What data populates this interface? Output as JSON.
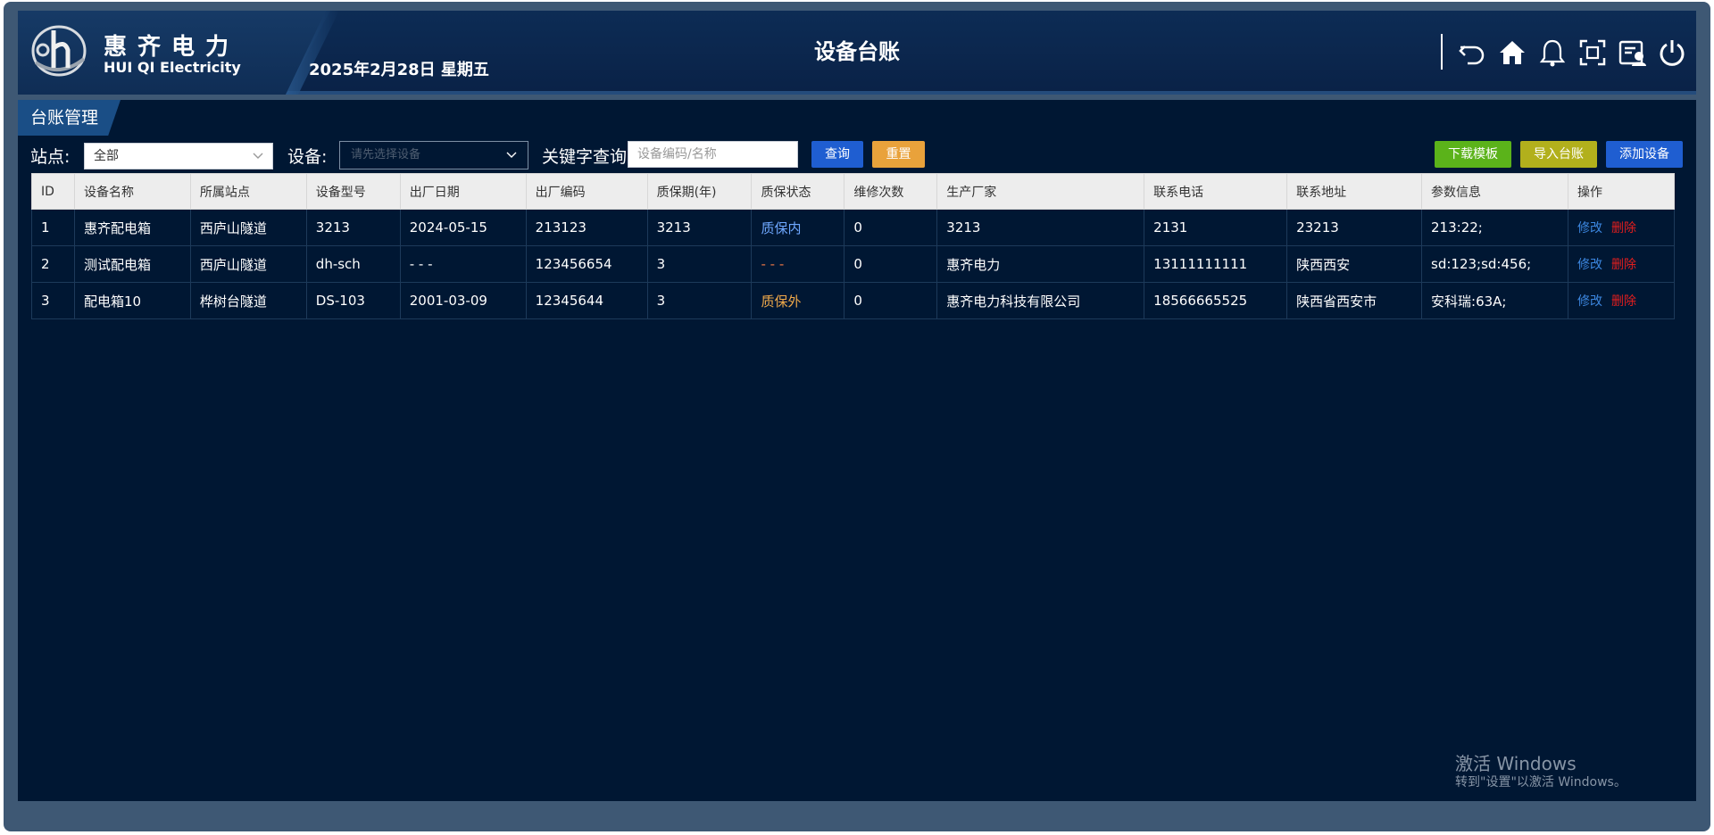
{
  "header": {
    "brand_cn": "惠齐电力",
    "brand_en": "HUI QI Electricity",
    "date": "2025年2月28日 星期五",
    "title": "设备台账",
    "icons": [
      "undo-icon",
      "home-icon",
      "bell-icon",
      "fullscreen-icon",
      "user-card-icon",
      "power-icon"
    ]
  },
  "section": {
    "tab": "台账管理"
  },
  "filters": {
    "station_label": "站点:",
    "station_value": "全部",
    "device_label": "设备:",
    "device_placeholder": "请先选择设备",
    "keyword_label": "关键字查询",
    "keyword_placeholder": "设备编码/名称",
    "query_button": "查询",
    "reset_button": "重置",
    "download_button": "下载模板",
    "import_button": "导入台账",
    "add_button": "添加设备"
  },
  "table": {
    "columns": [
      "ID",
      "设备名称",
      "所属站点",
      "设备型号",
      "出厂日期",
      "出厂编码",
      "质保期(年)",
      "质保状态",
      "维修次数",
      "生产厂家",
      "联系电话",
      "联系地址",
      "参数信息",
      "操作"
    ],
    "rows": [
      [
        "1",
        "惠齐配电箱",
        "西庐山隧道",
        "3213",
        "2024-05-15",
        "213123",
        "3213",
        "质保内",
        "0",
        "3213",
        "2131",
        "23213",
        "213:22;"
      ],
      [
        "2",
        "测试配电箱",
        "西庐山隧道",
        "dh-sch",
        "- - -",
        "123456654",
        "3",
        "- - -",
        "0",
        "惠齐电力",
        "13111111111",
        "陕西西安",
        "sd:123;sd:456;"
      ],
      [
        "3",
        "配电箱10",
        "桦树台隧道",
        "DS-103",
        "2001-03-09",
        "12345644",
        "3",
        "质保外",
        "0",
        "惠齐电力科技有限公司",
        "18566665525",
        "陕西省西安市",
        "安科瑞:63A;"
      ]
    ],
    "op_edit": "修改",
    "op_delete": "删除"
  },
  "colors": {
    "download": "#5bb31a",
    "import": "#b2b01c",
    "add": "#1f5ed1",
    "query": "#1f5ed1",
    "reset": "#e9a23b"
  },
  "watermark": {
    "line1": "激活 Windows",
    "line2": "转到\"设置\"以激活 Windows。"
  }
}
